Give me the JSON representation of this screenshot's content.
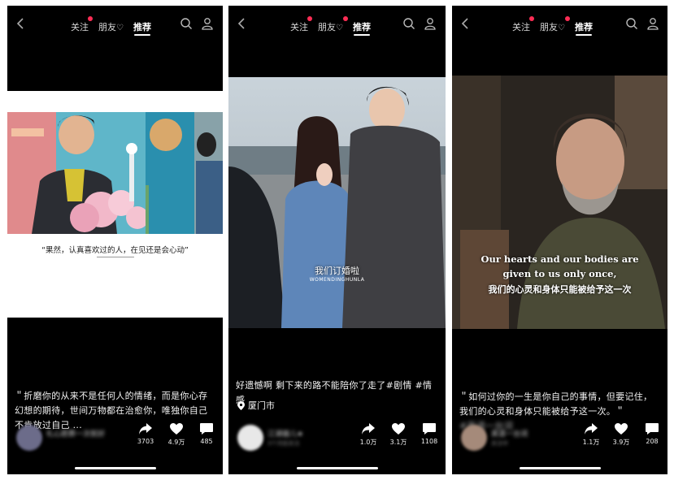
{
  "tabs": {
    "follow": "关注",
    "friends": "朋友",
    "recommend": "推荐",
    "heart": "♡"
  },
  "colors": {
    "accent": "#ff2d55",
    "background": "#000000"
  },
  "icons": [
    "back-icon",
    "search-icon",
    "profile-icon",
    "share-icon",
    "like-icon",
    "comment-icon",
    "location-icon"
  ],
  "posts": [
    {
      "overlay_text": "“果然，认真喜欢过的人，在见还是会心动”",
      "caption": "＂折磨你的从来不是任何人的情绪，而是你心存幻想的期待，世间万物都在治愈你，唯独你自己不肯放过自己 ...",
      "author": "礼心愿葬一次就好",
      "shares": "3703",
      "likes": "4.9万",
      "comments": "485"
    },
    {
      "overlay_text": "我们订婚啦",
      "overlay_subtext": "WOMENDINGHUNLA",
      "caption": "好遗憾啊 剩下来的路不能陪你了走了#剧情 #情感",
      "location": "厦门市",
      "author": "江湖雄儿★",
      "author_sub": "3个月前关注",
      "shares": "1.0万",
      "likes": "3.1万",
      "comments": "1108"
    },
    {
      "subtitle_en_1": "Our hearts and our bodies are",
      "subtitle_en_2": "given to us only once,",
      "subtitle_cn": "我们的心灵和身体只能被给予这一次",
      "caption_a": "＂如何过你的一生是你自己的事情，但要记住，我们的心灵和身体只能被给予这一次。＂",
      "caption_blur": "#英语一台词",
      "author": "英语一台词",
      "author_sub": "关注中",
      "shares": "1.1万",
      "likes": "3.9万",
      "comments": "208"
    }
  ]
}
